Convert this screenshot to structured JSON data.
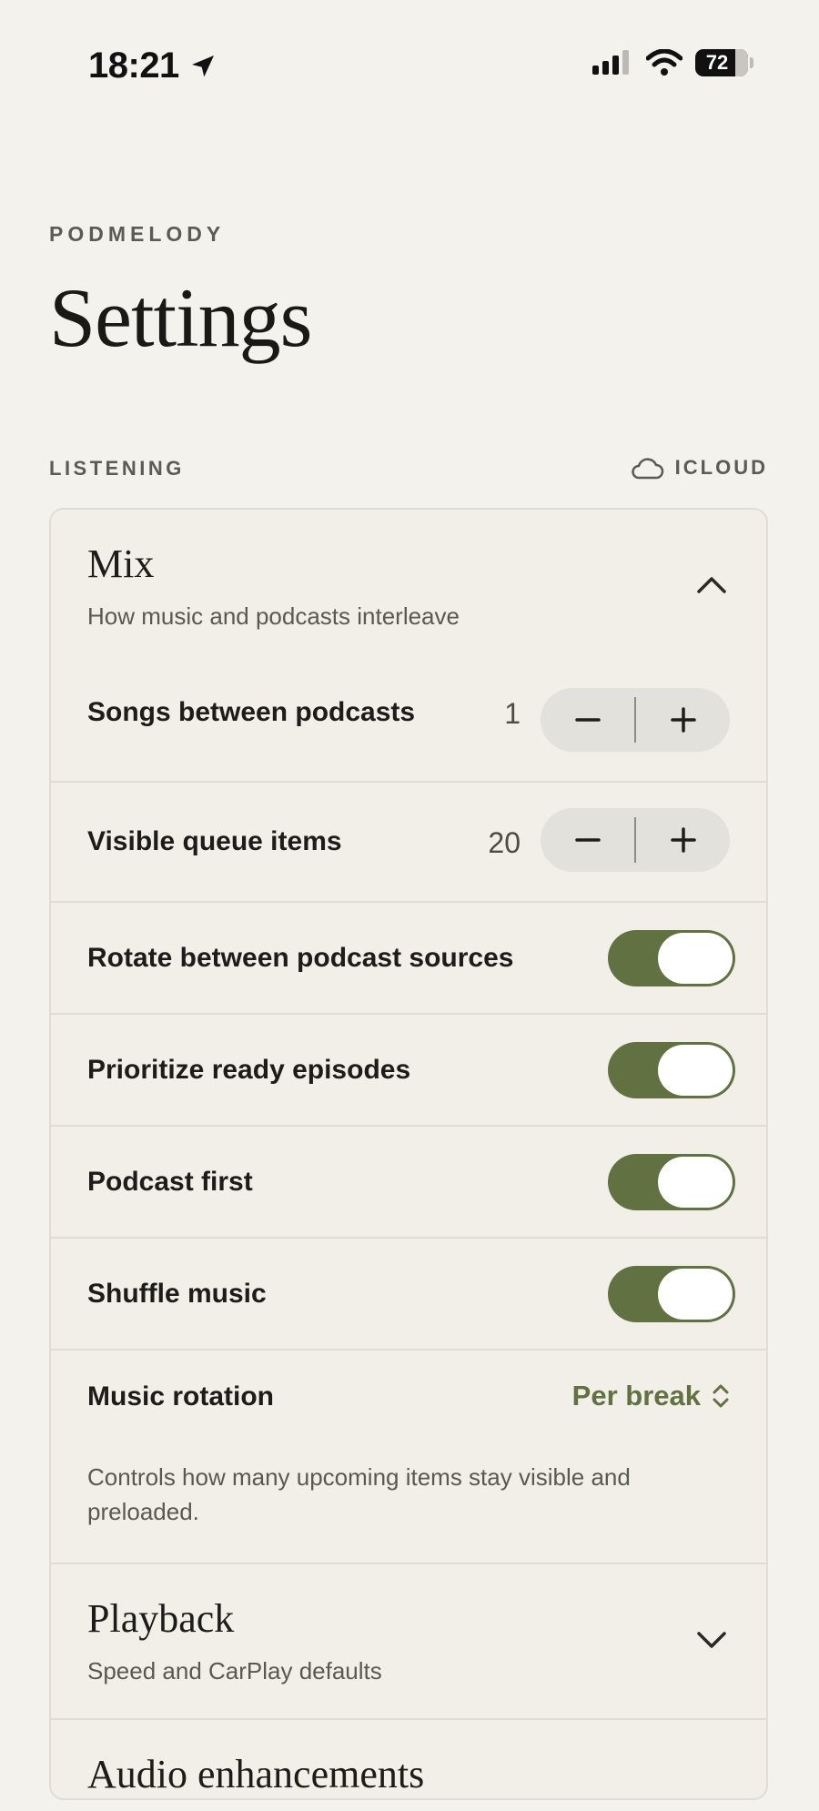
{
  "status_bar": {
    "time": "18:21",
    "battery": "72"
  },
  "header": {
    "brand": "PODMELODY",
    "title": "Settings"
  },
  "section": {
    "label": "LISTENING",
    "sync_label": "ICLOUD"
  },
  "mix": {
    "title": "Mix",
    "subtitle": "How music and podcasts interleave",
    "songs_between": {
      "label": "Songs between podcasts",
      "value": "1"
    },
    "visible_queue": {
      "label": "Visible queue items",
      "value": "20"
    },
    "toggles": [
      {
        "label": "Rotate between podcast sources",
        "on": true
      },
      {
        "label": "Prioritize ready episodes",
        "on": true
      },
      {
        "label": "Podcast first",
        "on": true
      },
      {
        "label": "Shuffle music",
        "on": true
      }
    ],
    "music_rotation": {
      "label": "Music rotation",
      "value": "Per break"
    },
    "helper": "Controls how many upcoming items stay visible and preloaded."
  },
  "playback": {
    "title": "Playback",
    "subtitle": "Speed and CarPlay defaults"
  },
  "audio": {
    "title": "Audio enhancements"
  },
  "colors": {
    "accent": "#617141",
    "background": "#f4f2ed"
  }
}
